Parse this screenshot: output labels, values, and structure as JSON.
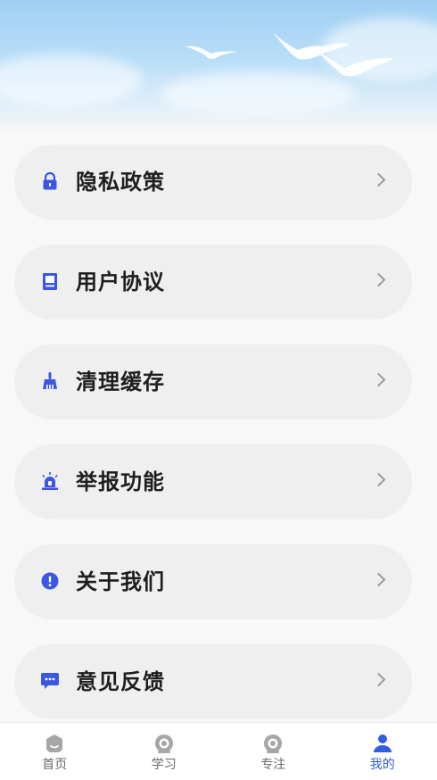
{
  "menu": {
    "items": [
      {
        "label": "隐私政策",
        "icon": "lock-icon"
      },
      {
        "label": "用户协议",
        "icon": "document-icon"
      },
      {
        "label": "清理缓存",
        "icon": "broom-icon"
      },
      {
        "label": "举报功能",
        "icon": "alarm-icon"
      },
      {
        "label": "关于我们",
        "icon": "info-icon"
      },
      {
        "label": "意见反馈",
        "icon": "feedback-icon"
      }
    ]
  },
  "tabbar": {
    "active_color": "#2f5de3",
    "inactive_color": "#9a9a9a",
    "tabs": [
      {
        "label": "首页",
        "icon": "home-icon",
        "active": false
      },
      {
        "label": "学习",
        "icon": "study-icon",
        "active": false
      },
      {
        "label": "专注",
        "icon": "focus-icon",
        "active": false
      },
      {
        "label": "我的",
        "icon": "profile-icon",
        "active": true
      }
    ]
  },
  "colors": {
    "accent": "#3a56e4",
    "card_bg": "#efefef",
    "page_bg": "#f8f8f8"
  }
}
